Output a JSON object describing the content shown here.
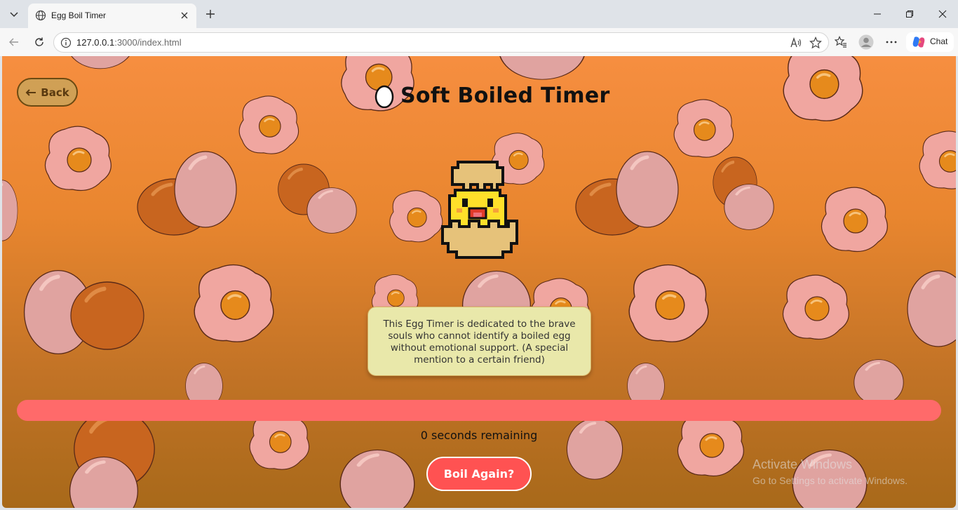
{
  "browser": {
    "tab_title": "Egg Boil Timer",
    "url_host": "127.0.0.1",
    "url_rest": ":3000/index.html",
    "chat_label": "Chat"
  },
  "page": {
    "back_label": "Back",
    "title": "Soft Boiled Timer",
    "note": "This Egg Timer is dedicated to the brave souls who cannot identify a boiled egg without emotional support. (A special mention to a certain friend)",
    "remaining": "0 seconds remaining",
    "boil_again_label": "Boil Again?",
    "progress": 0
  },
  "os": {
    "activate_title": "Activate Windows",
    "activate_sub": "Go to Settings to activate Windows."
  },
  "colors": {
    "accent": "#ff5252",
    "progress_track": "#ff6a6a",
    "note_bg": "#e9e8aa"
  },
  "icons": {
    "tab_menu": "chevron-down-icon",
    "tab_site": "globe-icon",
    "tab_close": "close-icon",
    "new_tab": "plus-icon",
    "back": "arrow-left-icon",
    "refresh": "refresh-icon",
    "info": "info-icon",
    "read_aloud": "read-aloud-icon",
    "favorite": "star-icon",
    "favorites": "favorites-icon",
    "profile": "avatar-icon",
    "more": "more-icon",
    "copilot": "copilot-icon",
    "title_egg": "egg-icon",
    "mascot": "chick-icon"
  }
}
